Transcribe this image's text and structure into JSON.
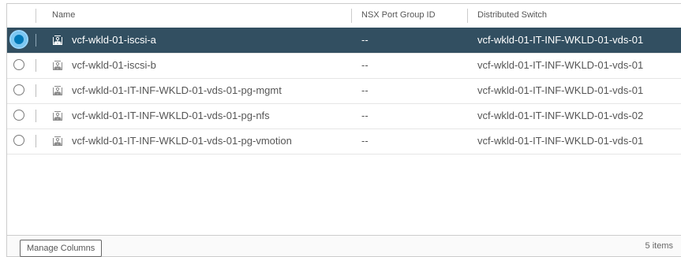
{
  "columns": {
    "name": "Name",
    "nsx_port_group_id": "NSX Port Group ID",
    "distributed_switch": "Distributed Switch"
  },
  "rows": [
    {
      "name": "vcf-wkld-01-iscsi-a",
      "nsx_port_group_id": "--",
      "distributed_switch": "vcf-wkld-01-IT-INF-WKLD-01-vds-01",
      "selected": true
    },
    {
      "name": "vcf-wkld-01-iscsi-b",
      "nsx_port_group_id": "--",
      "distributed_switch": "vcf-wkld-01-IT-INF-WKLD-01-vds-01",
      "selected": false
    },
    {
      "name": "vcf-wkld-01-IT-INF-WKLD-01-vds-01-pg-mgmt",
      "nsx_port_group_id": "--",
      "distributed_switch": "vcf-wkld-01-IT-INF-WKLD-01-vds-01",
      "selected": false
    },
    {
      "name": "vcf-wkld-01-IT-INF-WKLD-01-vds-01-pg-nfs",
      "nsx_port_group_id": "--",
      "distributed_switch": "vcf-wkld-01-IT-INF-WKLD-01-vds-02",
      "selected": false
    },
    {
      "name": "vcf-wkld-01-IT-INF-WKLD-01-vds-01-pg-vmotion",
      "nsx_port_group_id": "--",
      "distributed_switch": "vcf-wkld-01-IT-INF-WKLD-01-vds-01",
      "selected": false
    }
  ],
  "footer": {
    "manage_columns_label": "Manage Columns",
    "item_count": "5 items"
  },
  "icons": {
    "row_icon": "distributed-port-group-icon"
  },
  "colors": {
    "selected_row": "#324f61",
    "radio_selected": "#0079b8"
  }
}
